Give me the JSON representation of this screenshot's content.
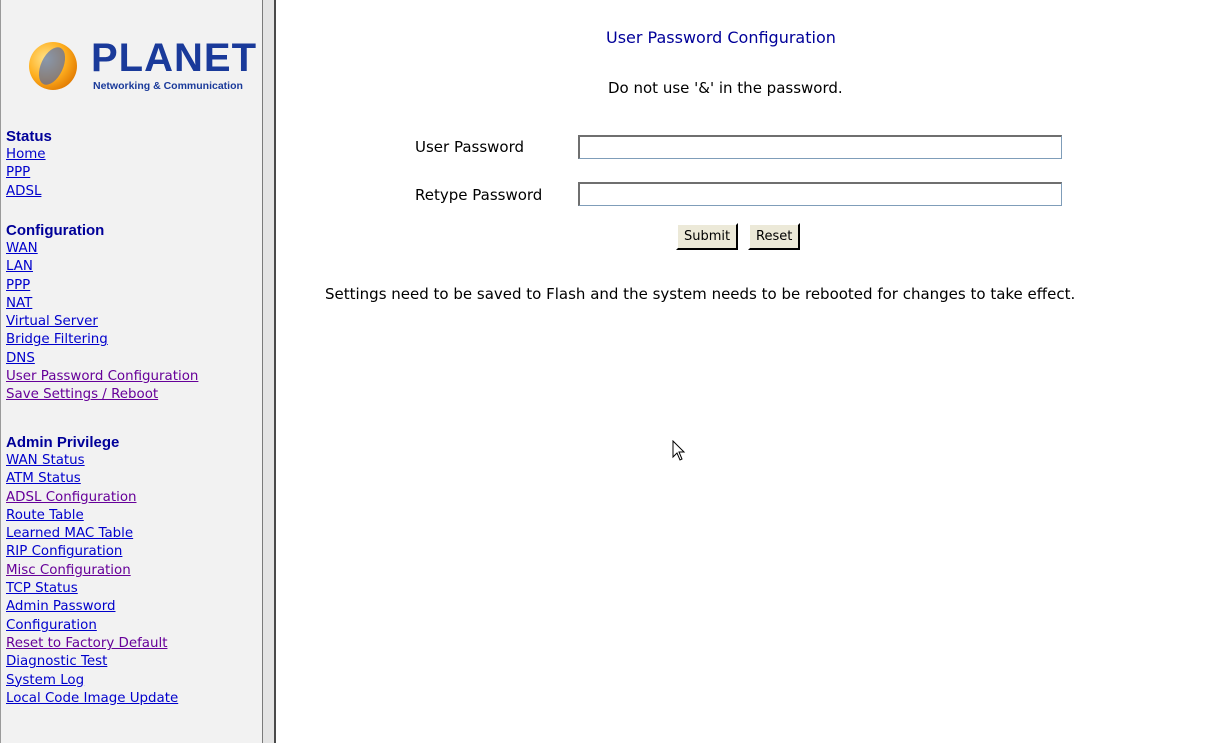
{
  "logo": {
    "brand": "PLANET",
    "tagline": "Networking & Communication"
  },
  "sidebar": {
    "status": {
      "heading": "Status",
      "links": [
        "Home",
        "PPP",
        "ADSL"
      ]
    },
    "configuration": {
      "heading": "Configuration",
      "links": [
        "WAN",
        "LAN",
        "PPP",
        "NAT",
        "Virtual Server",
        "Bridge Filtering",
        "DNS",
        "User Password Configuration",
        "Save Settings / Reboot"
      ]
    },
    "admin": {
      "heading": "Admin Privilege",
      "links": [
        "WAN Status",
        "ATM Status",
        "ADSL Configuration",
        "Route Table",
        "Learned MAC Table",
        "RIP Configuration",
        "Misc Configuration",
        "TCP Status",
        "Admin Password",
        "Configuration",
        "Reset to Factory Default",
        "Diagnostic Test",
        "System Log",
        "Local Code Image Update"
      ]
    }
  },
  "main": {
    "title": "User Password Configuration",
    "notice": "Do not use '&' in the password.",
    "user_password_label": "User Password",
    "user_password_value": "",
    "retype_password_label": "Retype Password",
    "retype_password_value": "",
    "submit_label": "Submit",
    "reset_label": "Reset",
    "footer_note": "Settings need to be saved to Flash and the system needs to be rebooted for changes to take effect."
  },
  "colors": {
    "heading_blue": "#000099",
    "link_blue": "#0000cc",
    "link_visited": "#660099",
    "brand_blue": "#1a3a9a"
  },
  "icons": {
    "logo_globe": "planet-globe-icon",
    "cursor": "mouse-pointer-icon"
  }
}
